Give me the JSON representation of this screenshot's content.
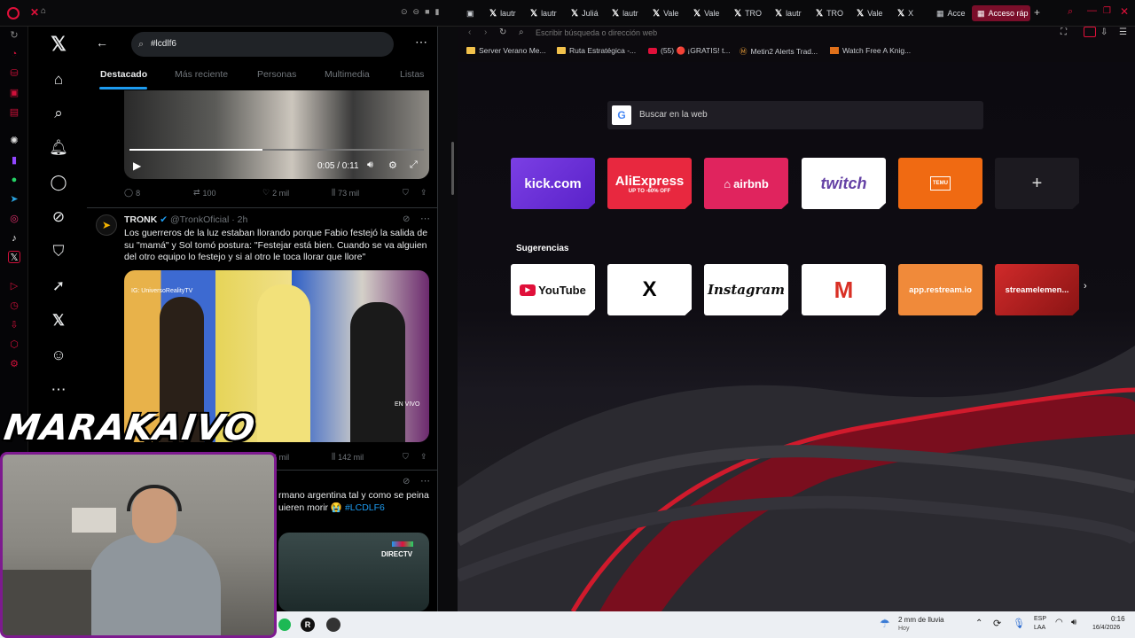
{
  "tabs": {
    "items": [
      {
        "label": "lautr"
      },
      {
        "label": "lautr"
      },
      {
        "label": "Juliá"
      },
      {
        "label": "lautr"
      },
      {
        "label": "Vale"
      },
      {
        "label": "Vale"
      },
      {
        "label": "TRO"
      },
      {
        "label": "lautr"
      },
      {
        "label": "TRO"
      },
      {
        "label": "Vale"
      },
      {
        "label": "X"
      },
      {
        "label": "Acce"
      },
      {
        "label": "Acceso ráp"
      }
    ]
  },
  "x": {
    "search_value": "#lcdlf6",
    "tabs": [
      "Destacado",
      "Más reciente",
      "Personas",
      "Multimedia",
      "Listas"
    ],
    "tweet1": {
      "video_time": "0:05 / 0:11",
      "replies": "8",
      "reposts": "100",
      "likes": "2 mil",
      "views": "73 mil"
    },
    "tweet2": {
      "name": "TRONK",
      "handle": "@TronkOficial",
      "time": "· 2h",
      "text": "Los guerreros de la luz estaban llorando porque Fabio festejó la salida de su \"mamá\" y Sol tomó postura: \"Festejar está bien. Cuando se va alguien del otro equipo lo festejo y si al otro le toca llorar que llore\"",
      "img_watermark": "IG: UniversoRealityTV",
      "img_live": "EN VIVO",
      "likes": "6 mil",
      "views": "142 mil"
    },
    "tweet3": {
      "text_line1": "rmano argentina tal y como se peina",
      "text_line2": "uieren morir 😭",
      "hashtag": "#LCDLF6",
      "img_brand": "DIRECTV"
    }
  },
  "browser": {
    "address_placeholder": "Escribir búsqueda o dirección web",
    "bookmarks": [
      {
        "label": "Server Verano Me..."
      },
      {
        "label": "Ruta Estratégica -..."
      },
      {
        "label": "(55) 🔴 ¡GRATIS! t..."
      },
      {
        "label": "Metin2 Alerts Trad..."
      },
      {
        "label": "Watch Free A Knig..."
      }
    ],
    "search_placeholder": "Buscar en la web",
    "speed_dial": [
      {
        "label": "kick.com",
        "color": "#6b2bd9"
      },
      {
        "label": "AliExpress",
        "sub": "UP TO -60% OFF",
        "color": "#e8283f"
      },
      {
        "label": "airbnb",
        "color": "#e0245e"
      },
      {
        "label": "twitch",
        "color": "#ffffff"
      },
      {
        "label": "TEMU",
        "color": "#f06a12"
      }
    ],
    "suggestions_title": "Sugerencias",
    "suggestions": [
      {
        "label": "YouTube",
        "color": "#ffffff"
      },
      {
        "label": "X",
        "color": "#ffffff"
      },
      {
        "label": "Instagram",
        "color": "#ffffff"
      },
      {
        "label": "M",
        "color": "#ffffff"
      },
      {
        "label": "app.restream.io",
        "color": "#f08a3a"
      },
      {
        "label": "streamelemen...",
        "color": "#c0282a"
      }
    ]
  },
  "overlay": {
    "logo_text": "MARAKAIVO"
  },
  "taskbar": {
    "weather": "2 mm de lluvia",
    "weather_sub": "Hoy",
    "lang": "ESP",
    "lang_sub": "LAA",
    "time": "0:16",
    "date": "16/4/2026"
  }
}
